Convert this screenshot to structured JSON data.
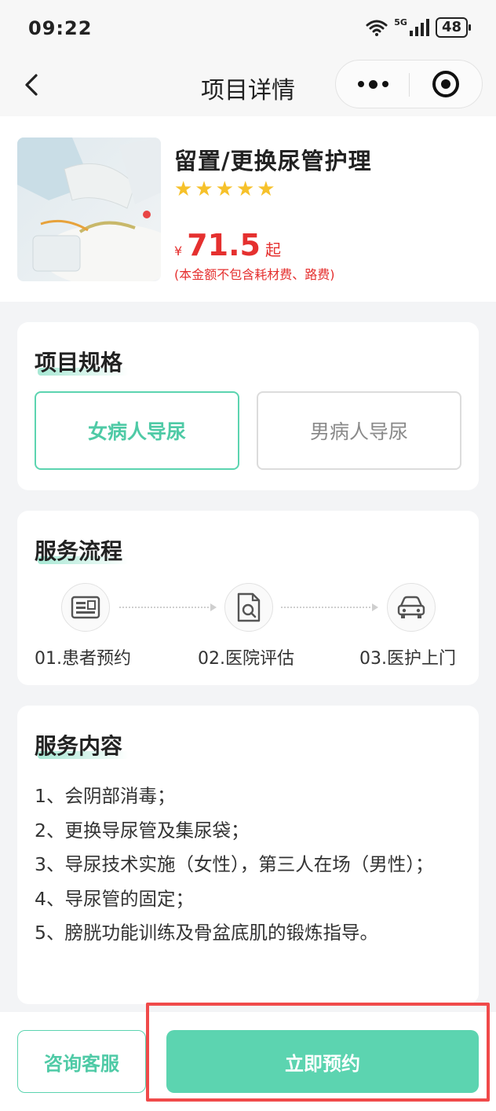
{
  "status_bar": {
    "time": "09:22",
    "network": "5G",
    "battery": "48"
  },
  "nav": {
    "title": "项目详情"
  },
  "product": {
    "name": "留置/更换尿管护理",
    "rating": 5,
    "stars": [
      "★",
      "★",
      "★",
      "★",
      "★"
    ],
    "currency_symbol": "¥",
    "price": "71.5",
    "price_suffix": "起",
    "price_note": "(本金额不包含耗材费、路费)"
  },
  "spec": {
    "title": "项目规格",
    "options": [
      {
        "label": "女病人导尿",
        "selected": true
      },
      {
        "label": "男病人导尿",
        "selected": false
      }
    ]
  },
  "flow": {
    "title": "服务流程",
    "steps": [
      {
        "label": "01.患者预约",
        "icon": "id-card-icon"
      },
      {
        "label": "02.医院评估",
        "icon": "document-search-icon"
      },
      {
        "label": "03.医护上门",
        "icon": "car-icon"
      }
    ]
  },
  "content": {
    "title": "服务内容",
    "items": [
      "1、会阴部消毒；",
      "2、更换导尿管及集尿袋；",
      "3、导尿技术实施（女性），第三人在场（男性）；",
      "4、导尿管的固定；",
      "5、膀胱功能训练及骨盆底肌的锻炼指导。"
    ]
  },
  "bottom": {
    "consult_label": "咨询客服",
    "book_label": "立即预约"
  },
  "colors": {
    "accent": "#5cd4b0",
    "price": "#e5302f",
    "star": "#f6c12a",
    "highlight": "#f04a4a"
  }
}
